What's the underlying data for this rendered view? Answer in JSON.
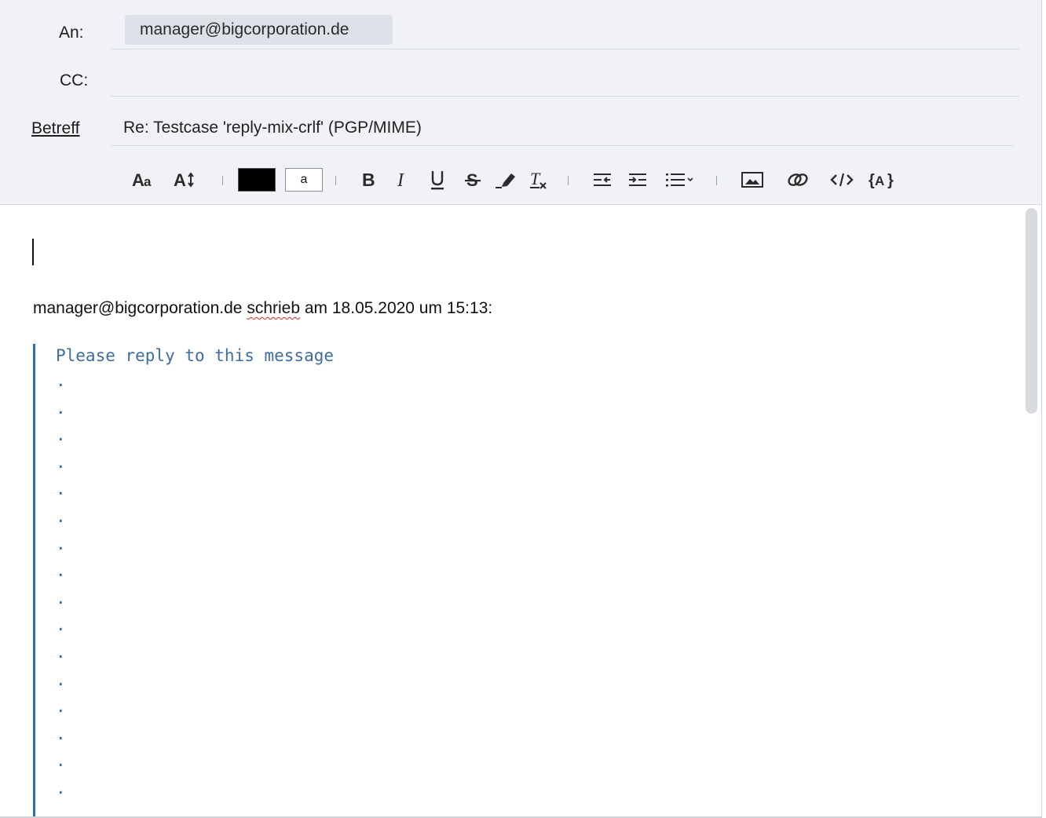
{
  "header": {
    "to_label": "An:",
    "cc_label": "CC:",
    "subject_label": "Betreff",
    "recipient": "manager@bigcorporation.de",
    "subject": "Re: Testcase 'reply-mix-crlf' (PGP/MIME)"
  },
  "toolbar": {
    "bg_swatch_letter": "a",
    "text_color": "#000000"
  },
  "body": {
    "attribution_pre": "manager@bigcorporation.de ",
    "attribution_squiggle": "schrieb",
    "attribution_post": " am 18.05.2020 um 15:13:",
    "quote_first_line": "Please reply to this message",
    "quote_dot": "."
  },
  "colors": {
    "quote_bar": "#3c6ea6",
    "quote_text": "#3f6d9e",
    "header_bg": "#f0f2f5"
  }
}
